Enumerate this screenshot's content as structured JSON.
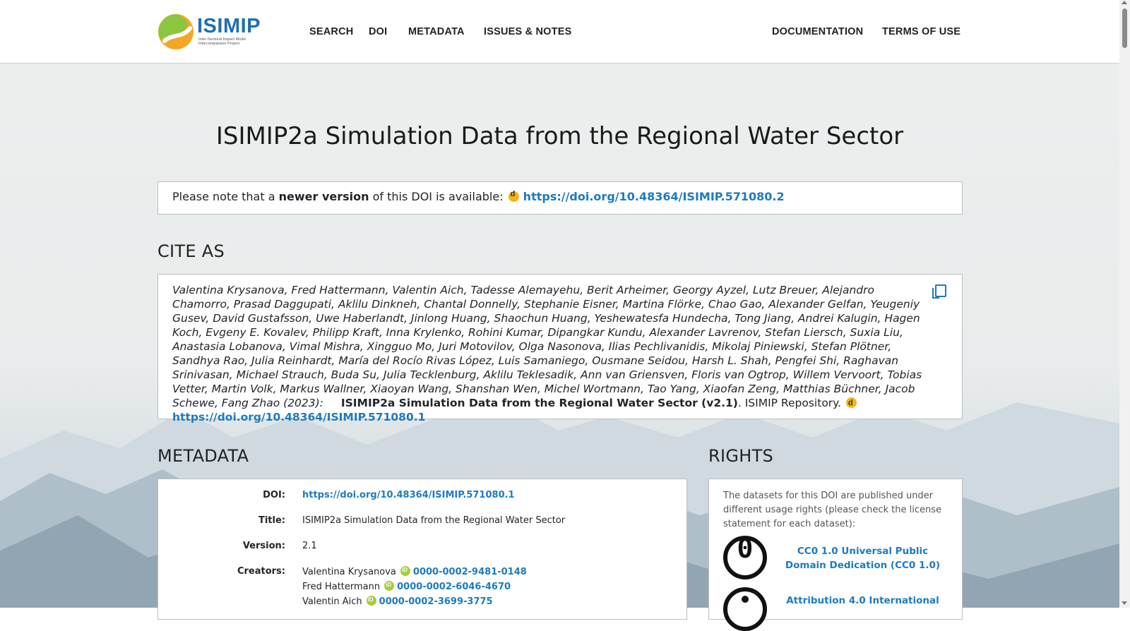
{
  "logo": {
    "name": "ISIMIP",
    "subtitle": "Inter-Sectoral Impact Model Intercomparison Project"
  },
  "nav": {
    "left": [
      "SEARCH",
      "DOI",
      "METADATA",
      "ISSUES & NOTES"
    ],
    "right": [
      "DOCUMENTATION",
      "TERMS OF USE"
    ]
  },
  "page": {
    "title": "ISIMIP2a Simulation Data from the Regional Water Sector"
  },
  "notice": {
    "prefix": "Please note that a ",
    "emphasis": "newer version",
    "suffix": " of this DOI is available: ",
    "link": "https://doi.org/10.48364/ISIMIP.571080.2"
  },
  "cite": {
    "heading": "CITE AS",
    "authors": "Valentina Krysanova, Fred Hattermann, Valentin Aich, Tadesse Alemayehu, Berit Arheimer, Georgy Ayzel, Lutz Breuer, Alejandro Chamorro, Prasad Daggupati, Aklilu Dinkneh, Chantal Donnelly, Stephanie Eisner, Martina Flörke, Chao Gao, Alexander Gelfan, Yeugeniy Gusev, David Gustafsson, Uwe Haberlandt, Jinlong Huang, Shaochun Huang, Yeshewatesfa Hundecha, Tong Jiang, Andrei Kalugin, Hagen Koch, Evgeny E. Kovalev, Philipp Kraft, Inna Krylenko, Rohini Kumar, Dipangkar Kundu, Alexander Lavrenov, Stefan Liersch, Suxia Liu, Anastasia Lobanova, Vimal Mishra, Xingguo Mo, Juri Motovilov, Olga Nasonova, Ilias Pechlivanidis, Mikolaj Piniewski, Stefan Plötner, Sandhya Rao, Julia Reinhardt, María del Rocío Rivas López, Luis Samaniego, Ousmane Seidou, Harsh L. Shah, Pengfei Shi, Raghavan Srinivasan, Michael Strauch, Buda Su, Julia Tecklenburg, Aklilu Teklesadik, Ann van Griensven, Floris van Ogtrop, Willem Vervoort, Tobias Vetter, Martin Volk, Markus Wallner, Xiaoyan Wang, Shanshan Wen, Michel Wortmann, Tao Yang, Xiaofan Zeng, Matthias Büchner, Jacob Schewe, Fang Zhao (2023):",
    "title": "ISIMIP2a Simulation Data from the Regional Water Sector (v2.1)",
    "repository": ". ISIMIP Repository. ",
    "link": "https://doi.org/10.48364/ISIMIP.571080.1"
  },
  "metadata": {
    "heading": "METADATA",
    "doi_label": "DOI:",
    "doi_value": "https://doi.org/10.48364/ISIMIP.571080.1",
    "title_label": "Title:",
    "title_value": "ISIMIP2a Simulation Data from the Regional Water Sector",
    "version_label": "Version:",
    "version_value": "2.1",
    "creators_label": "Creators:",
    "creators": [
      {
        "name": "Valentina Krysanova",
        "orcid": "0000-0002-9481-0148"
      },
      {
        "name": "Fred Hattermann",
        "orcid": "0000-0002-6046-4670"
      },
      {
        "name": "Valentin Aich",
        "orcid": "0000-0002-3699-3775"
      }
    ]
  },
  "rights": {
    "heading": "RIGHTS",
    "text": "The datasets for this DOI are published under different usage rights (please check the license statement for each dataset):",
    "licenses": [
      "CC0 1.0 Universal Public Domain Dedication (CC0 1.0)",
      "Attribution 4.0 International"
    ],
    "cc0_symbol": "0"
  }
}
